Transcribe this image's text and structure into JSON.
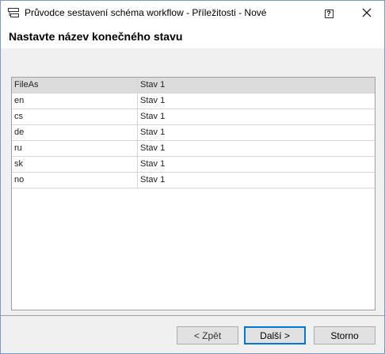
{
  "window": {
    "title": "Průvodce sestavení schéma workflow - Příležitosti - Nové",
    "icon": "workflow-wizard-icon",
    "help_label": "?"
  },
  "header": {
    "heading": "Nastavte název konečného stavu"
  },
  "grid": {
    "rows": [
      {
        "key": "FileAs",
        "value": "Stav 1",
        "selected": true
      },
      {
        "key": "en",
        "value": "Stav 1"
      },
      {
        "key": "cs",
        "value": "Stav 1"
      },
      {
        "key": "de",
        "value": "Stav 1"
      },
      {
        "key": "ru",
        "value": "Stav 1"
      },
      {
        "key": "sk",
        "value": "Stav 1"
      },
      {
        "key": "no",
        "value": "Stav 1"
      }
    ]
  },
  "footer": {
    "back_label": "< Zpět",
    "next_label": "Další >",
    "cancel_label": "Storno"
  },
  "colors": {
    "default_button_border": "#0078d7",
    "selected_row": "#dcdcdc"
  }
}
